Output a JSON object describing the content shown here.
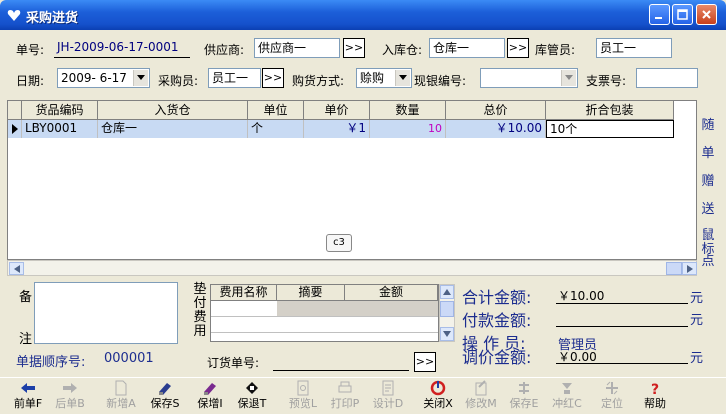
{
  "window": {
    "title": "采购进货"
  },
  "header": {
    "order_no_label": "单号:",
    "order_no_value": "JH-2009-06-17-0001",
    "supplier_label": "供应商:",
    "supplier_value": "供应商一",
    "select_btn": ">>",
    "warehouse_label": "入库仓:",
    "warehouse_value": "仓库一",
    "keeper_label": "库管员:",
    "keeper_value": "员工一",
    "date_label": "日期:",
    "date_value": "2009- 6-17",
    "buyer_label": "采购员:",
    "buyer_value": "员工一",
    "pay_mode_label": "购货方式:",
    "pay_mode_value": "赊购",
    "cash_no_label": "现银编号:",
    "cash_no_value": "",
    "invoice_label": "支票号:",
    "invoice_value": ""
  },
  "grid": {
    "columns": [
      "货品编码",
      "入货仓",
      "单位",
      "单价",
      "数量",
      "总价",
      "折合包装"
    ],
    "rows": [
      {
        "code": "LBY0001",
        "warehouse": "仓库一",
        "unit": "个",
        "price": "￥1",
        "qty": "10",
        "total": "￥10.00",
        "pack": "10个"
      }
    ]
  },
  "side_buttons": [
    "随",
    "单",
    "赠",
    "送",
    "鼠",
    "标",
    "点"
  ],
  "tooltip_tag": "c3",
  "footer": {
    "memo_label_top": "备",
    "memo_label_bottom": "注",
    "fee_vertical_label": [
      "垫",
      "付",
      "费",
      "用"
    ],
    "fee_columns": [
      "费用名称",
      "摘要",
      "金额"
    ],
    "seq_label": "单据顺序号:",
    "seq_value": "000001",
    "order_ref_label": "订货单号:",
    "order_ref_value": "",
    "total_label": "合计金额:",
    "total_value": "￥10.00",
    "paid_label": "付款金额:",
    "paid_value": "",
    "operator_label": "操 作 员:",
    "operator_value": "管理员",
    "adjust_label": "调价金额:",
    "adjust_value": "￥0.00",
    "unit_yuan": "元"
  },
  "toolbar": [
    {
      "label": "前单F",
      "icon": "arrow-left-icon",
      "enabled": true
    },
    {
      "label": "后单B",
      "icon": "arrow-right-icon",
      "enabled": false
    },
    {
      "label": "新增A",
      "icon": "new-doc-icon",
      "enabled": false
    },
    {
      "label": "保存S",
      "icon": "save-icon",
      "enabled": true
    },
    {
      "label": "保增I",
      "icon": "save-add-icon",
      "enabled": true
    },
    {
      "label": "保退T",
      "icon": "save-exit-icon",
      "enabled": true
    },
    {
      "label": "预览L",
      "icon": "preview-icon",
      "enabled": false
    },
    {
      "label": "打印P",
      "icon": "print-icon",
      "enabled": false
    },
    {
      "label": "设计D",
      "icon": "design-icon",
      "enabled": false
    },
    {
      "label": "关闭X",
      "icon": "close-icon",
      "enabled": true
    },
    {
      "label": "修改M",
      "icon": "edit-icon",
      "enabled": false
    },
    {
      "label": "保存E",
      "icon": "save2-icon",
      "enabled": false
    },
    {
      "label": "冲红C",
      "icon": "reverse-icon",
      "enabled": false
    },
    {
      "label": "定位",
      "icon": "locate-icon",
      "enabled": false
    },
    {
      "label": "帮助",
      "icon": "help-icon",
      "enabled": true
    }
  ]
}
